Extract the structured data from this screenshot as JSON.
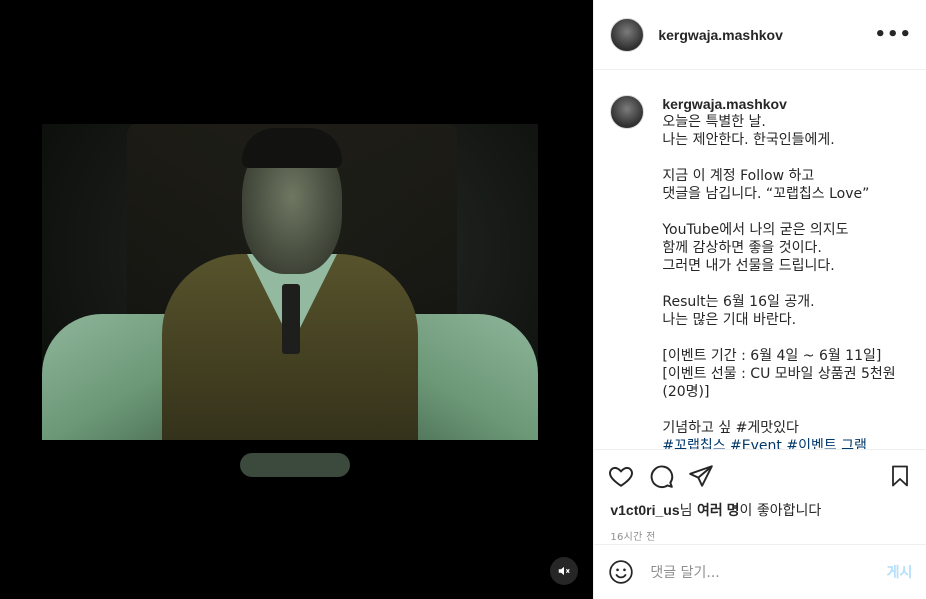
{
  "post": {
    "username": "kergwaja.mashkov",
    "more_label": "•••"
  },
  "caption": {
    "username": "kergwaja.mashkov",
    "lines": [
      "오늘은 특별한 날.",
      "나는 제안한다. 한국인들에게.",
      "",
      "지금 이 계정 Follow 하고",
      "댓글을 남깁니다. “꼬랩칩스 Love”",
      "",
      "YouTube에서 나의 굳은 의지도",
      "함께 감상하면 좋을 것이다.",
      "그러면 내가 선물을 드립니다.",
      "",
      "Result는 6월 16일 공개.",
      "나는 많은 기대 바란다.",
      "",
      "[이벤트 기간 : 6월 4일 ~ 6월 11일]",
      "[이벤트 선물 : CU 모바일 상품권 5천원",
      "(20명)]",
      "",
      "기념하고 싶 #게맛있다",
      "#꼬랩칩스 #Event #이벤트 그램"
    ]
  },
  "likes": {
    "user": "v1ct0ri_us",
    "suffix": "님 ",
    "others": "여러 명",
    "tail": "이 좋아합니다"
  },
  "time_ago": "16시간 전",
  "comment_box": {
    "placeholder": "댓글 달기...",
    "post_label": "게시"
  },
  "icons": {
    "like": "heart-icon",
    "comment": "comment-icon",
    "share": "paper-plane-icon",
    "save": "bookmark-icon",
    "emoji": "smiley-icon",
    "mute": "speaker-muted-icon"
  },
  "colors": {
    "link": "#00376b",
    "text": "#262626",
    "muted": "#8e8e8e",
    "post_disabled": "#b2dffc"
  }
}
